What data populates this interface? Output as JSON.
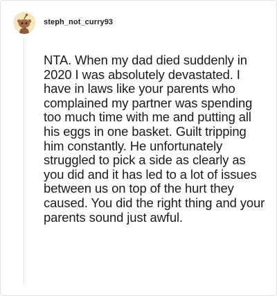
{
  "comment": {
    "author": {
      "username": "steph_not_curry93",
      "avatar_icon": "snoo-avatar-icon",
      "avatar_bg": "#f5e7bd"
    },
    "body": "NTA. When my dad died suddenly in 2020 I was absolutely devastated. I have in laws like your parents who complained my partner was spending too much time with me and putting all his eggs in one basket. Guilt tripping him constantly. He unfortunately struggled to pick a side as clearly as you did and it has led to a lot of issues between us on top of the hurt they caused. You did the right thing and your parents sound just awful."
  }
}
